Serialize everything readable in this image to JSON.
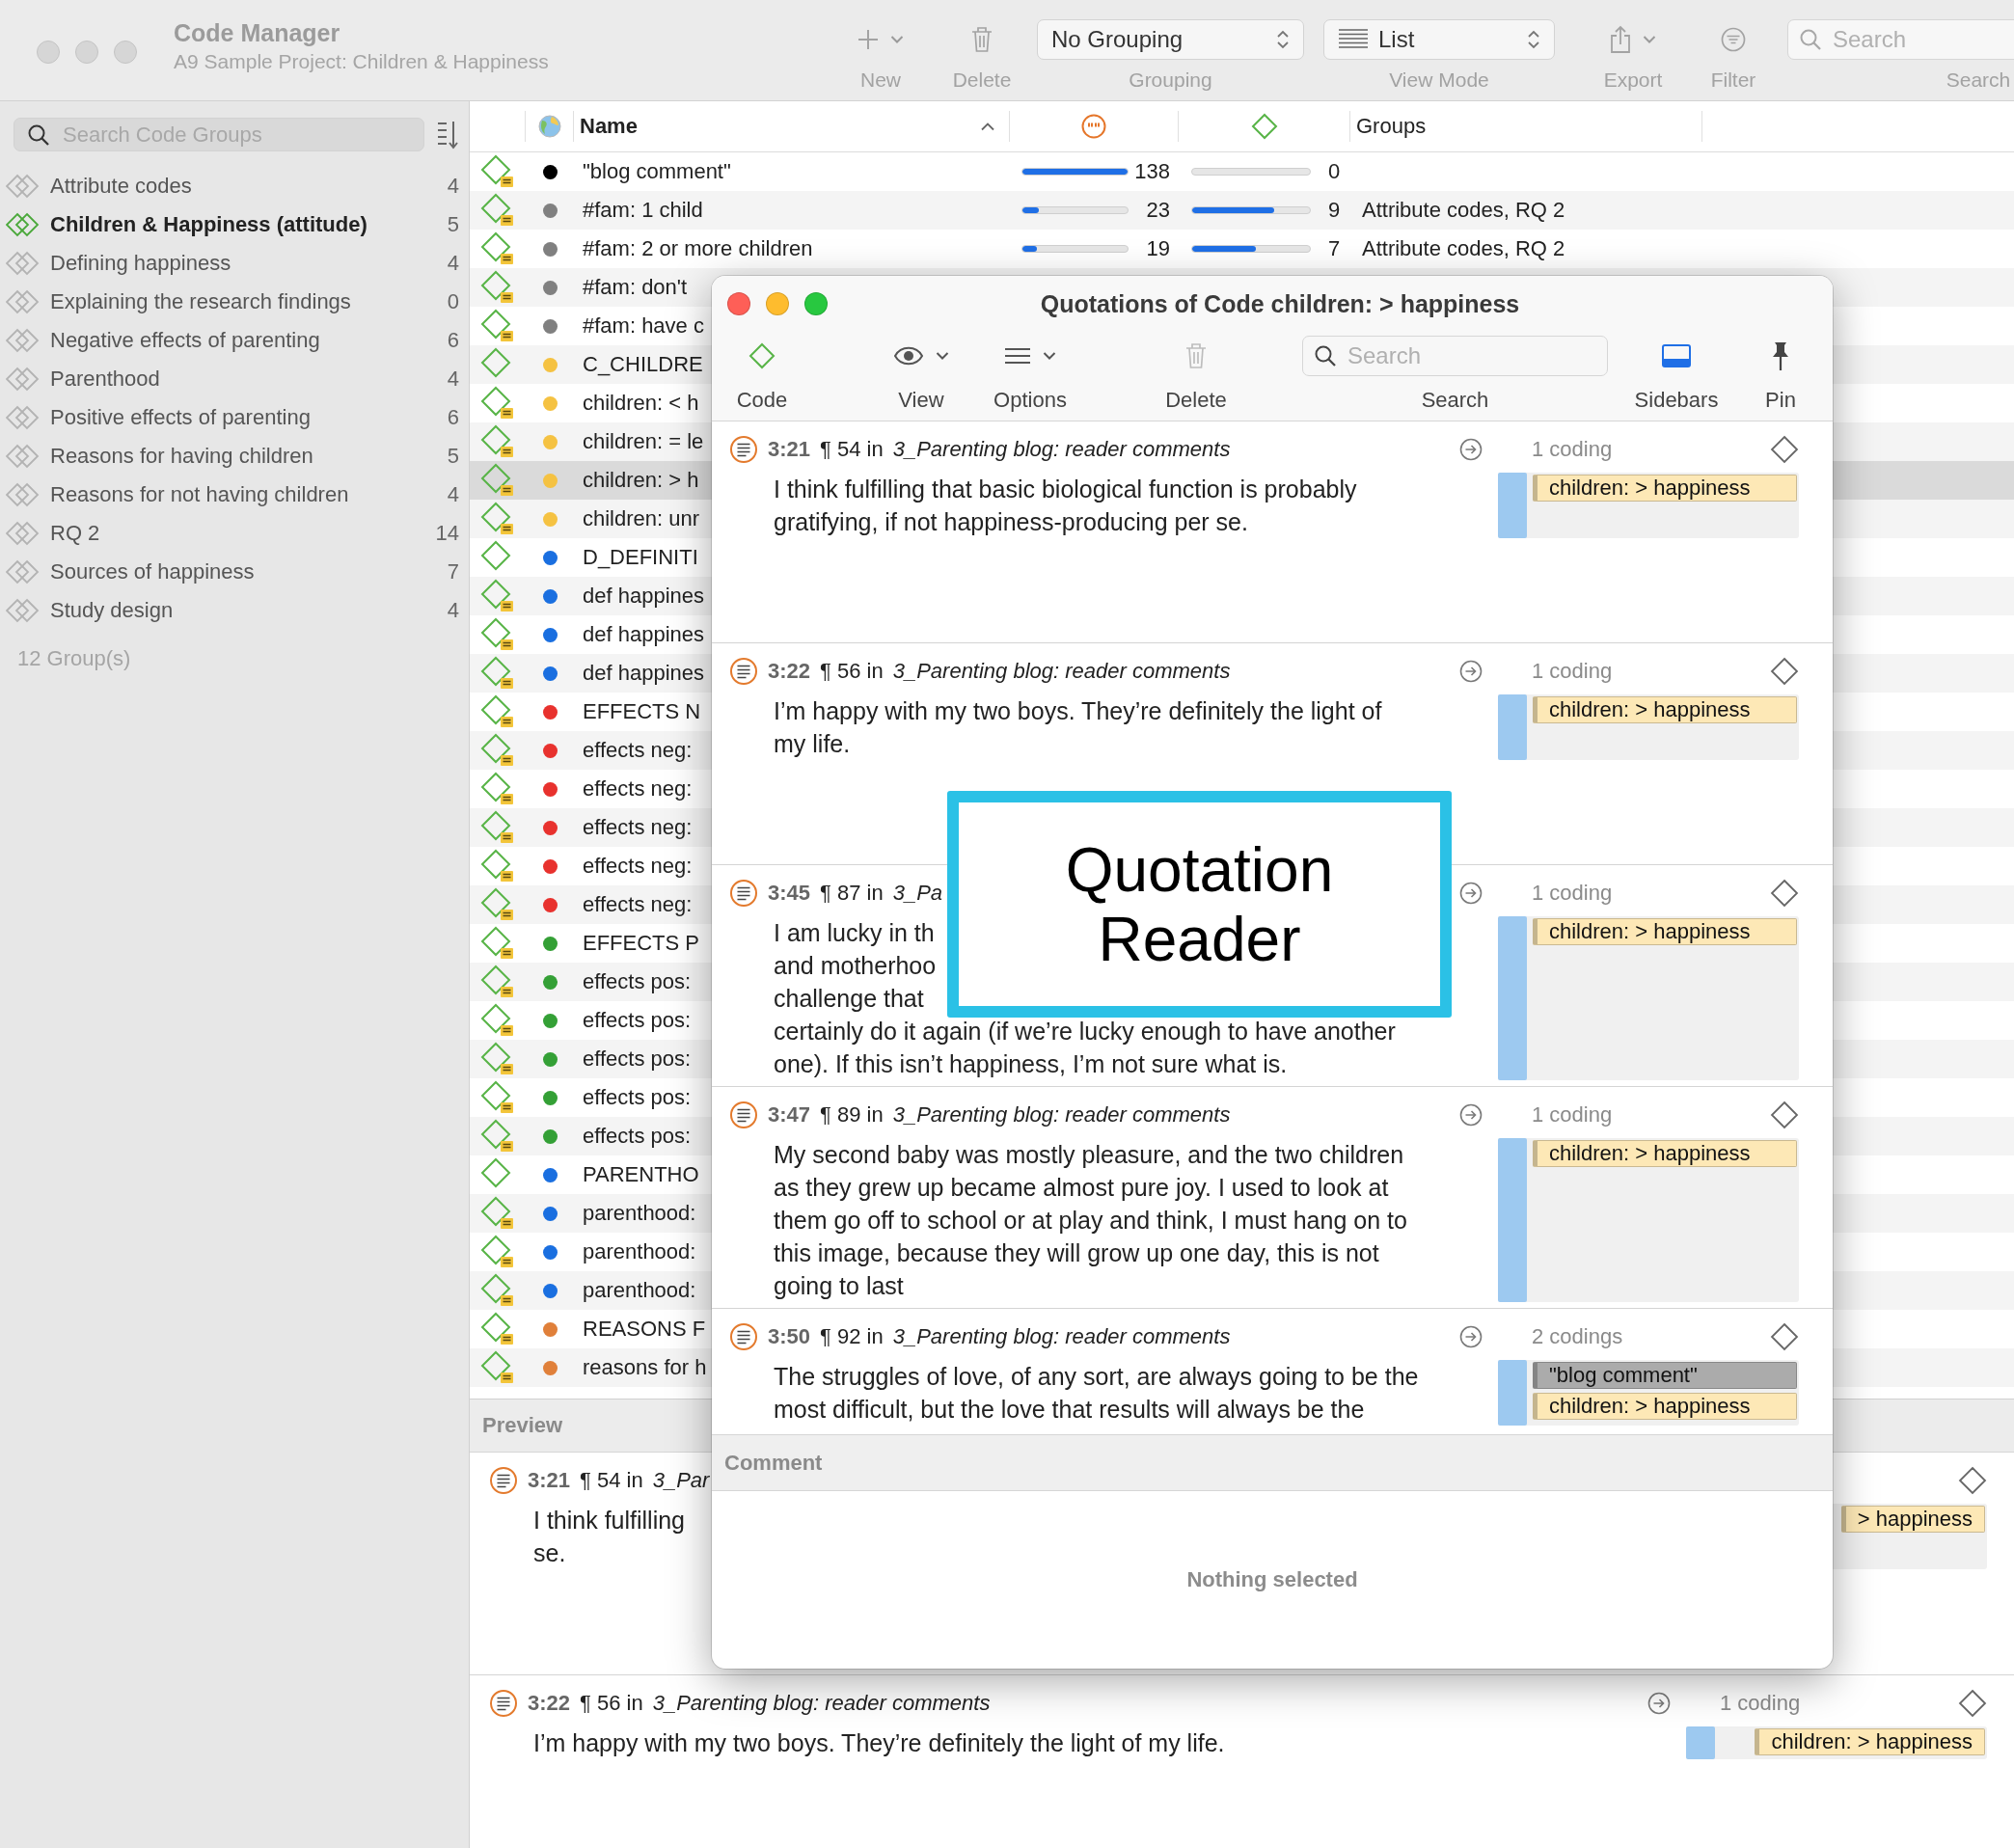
{
  "window": {
    "title": "Code Manager",
    "subtitle": "A9 Sample Project: Children & Happiness"
  },
  "toolbar": {
    "items": [
      {
        "kind": "new",
        "label": "New"
      },
      {
        "kind": "delete",
        "label": "Delete"
      },
      {
        "kind": "popup",
        "value": "No Grouping",
        "label": "Grouping"
      },
      {
        "kind": "popup-list",
        "value": "List",
        "label": "View Mode"
      },
      {
        "kind": "export",
        "label": "Export"
      },
      {
        "kind": "filter",
        "label": "Filter"
      },
      {
        "kind": "search",
        "placeholder": "Search",
        "label": "Search"
      }
    ]
  },
  "sidebar": {
    "search_placeholder": "Search Code Groups",
    "items": [
      {
        "label": "Attribute codes",
        "count": "4",
        "selected": false
      },
      {
        "label": "Children & Happiness (attitude)",
        "count": "5",
        "selected": true
      },
      {
        "label": "Defining happiness",
        "count": "4",
        "selected": false
      },
      {
        "label": "Explaining the research findings",
        "count": "0",
        "selected": false
      },
      {
        "label": "Negative effects of parenting",
        "count": "6",
        "selected": false
      },
      {
        "label": "Parenthood",
        "count": "4",
        "selected": false
      },
      {
        "label": "Positive effects of parenting",
        "count": "6",
        "selected": false
      },
      {
        "label": "Reasons for having children",
        "count": "5",
        "selected": false
      },
      {
        "label": "Reasons for not having children",
        "count": "4",
        "selected": false
      },
      {
        "label": "RQ 2",
        "count": "14",
        "selected": false
      },
      {
        "label": "Sources of happiness",
        "count": "7",
        "selected": false
      },
      {
        "label": "Study design",
        "count": "4",
        "selected": false
      }
    ],
    "footer": "12 Group(s)"
  },
  "table": {
    "columns": [
      {
        "kind": "globe"
      },
      {
        "kind": "text",
        "label": "Name",
        "sorted": true
      },
      {
        "kind": "quote"
      },
      {
        "kind": "code"
      },
      {
        "kind": "text",
        "label": "Groups"
      }
    ],
    "rows": [
      {
        "name": "\"blog comment\"",
        "color": "#000000",
        "commented": true,
        "selected": false,
        "column_3": {
          "level": 1,
          "count": "138"
        },
        "column_4": {
          "level": 0,
          "count": "0"
        }
      },
      {
        "name": "#fam: 1 child",
        "color": "#808080",
        "commented": true,
        "selected": false,
        "column_3": {
          "level": 0.16,
          "count": "23"
        },
        "column_4": {
          "level": 0.7,
          "count": "9"
        },
        "groups": "Attribute codes, RQ 2"
      },
      {
        "name": "#fam: 2 or more  children",
        "color": "#808080",
        "commented": true,
        "selected": false,
        "column_3": {
          "level": 0.14,
          "count": "19"
        },
        "column_4": {
          "level": 0.54,
          "count": "7"
        },
        "groups": "Attribute codes, RQ 2"
      },
      {
        "name": "#fam: don't",
        "color": "#808080",
        "commented": true,
        "selected": false
      },
      {
        "name": "#fam: have c",
        "color": "#808080",
        "commented": true,
        "selected": false
      },
      {
        "name": "C_CHILDRE",
        "color": "#f5c242",
        "commented": false,
        "selected": false
      },
      {
        "name": "children: < h",
        "color": "#f5c242",
        "commented": true,
        "selected": false
      },
      {
        "name": "children: = le",
        "color": "#f5c242",
        "commented": true,
        "selected": false
      },
      {
        "name": "children: > h",
        "color": "#f5c242",
        "commented": true,
        "selected": true
      },
      {
        "name": "children: unr",
        "color": "#f5c242",
        "commented": true,
        "selected": false
      },
      {
        "name": "D_DEFINITI",
        "color": "#1a6fe0",
        "commented": false,
        "selected": false
      },
      {
        "name": "def happines",
        "color": "#1a6fe0",
        "commented": true,
        "selected": false
      },
      {
        "name": "def happines",
        "color": "#1a6fe0",
        "commented": true,
        "selected": false
      },
      {
        "name": "def happines",
        "color": "#1a6fe0",
        "commented": true,
        "selected": false
      },
      {
        "name": "EFFECTS N",
        "color": "#e8322e",
        "commented": true,
        "selected": false
      },
      {
        "name": "effects neg:",
        "color": "#e8322e",
        "commented": true,
        "selected": false
      },
      {
        "name": "effects neg:",
        "color": "#e8322e",
        "commented": true,
        "selected": false
      },
      {
        "name": "effects neg:",
        "color": "#e8322e",
        "commented": true,
        "selected": false
      },
      {
        "name": "effects neg:",
        "color": "#e8322e",
        "commented": true,
        "selected": false
      },
      {
        "name": "effects neg:",
        "color": "#e8322e",
        "commented": true,
        "selected": false
      },
      {
        "name": "EFFECTS P",
        "color": "#34a036",
        "commented": true,
        "selected": false
      },
      {
        "name": "effects pos:",
        "color": "#34a036",
        "commented": true,
        "selected": false
      },
      {
        "name": "effects pos:",
        "color": "#34a036",
        "commented": true,
        "selected": false
      },
      {
        "name": "effects pos:",
        "color": "#34a036",
        "commented": true,
        "selected": false
      },
      {
        "name": "effects pos:",
        "color": "#34a036",
        "commented": true,
        "selected": false
      },
      {
        "name": "effects pos:",
        "color": "#34a036",
        "commented": true,
        "selected": false
      },
      {
        "name": "PARENTHO",
        "color": "#1a6fe0",
        "commented": false,
        "selected": false
      },
      {
        "name": "parenthood:",
        "color": "#1a6fe0",
        "commented": true,
        "selected": false
      },
      {
        "name": "parenthood:",
        "color": "#1a6fe0",
        "commented": true,
        "selected": false
      },
      {
        "name": "parenthood:",
        "color": "#1a6fe0",
        "commented": true,
        "selected": false
      },
      {
        "name": "REASONS F",
        "color": "#e0803a",
        "commented": true,
        "selected": false
      },
      {
        "name": "reasons for h",
        "color": "#e0803a",
        "commented": true,
        "selected": false
      }
    ]
  },
  "preview": {
    "title": "Preview",
    "items": [
      {
        "number": "3:21",
        "location": "¶ 54 in",
        "source": "3_Par",
        "lines": [
          "I think fulfilling",
          "se."
        ],
        "codes": [
          {
            "label": "> happiness",
            "color": "#fde8b6"
          }
        ]
      },
      {
        "number": "3:22",
        "location": "¶ 56 in",
        "source": "3_Parenting blog: reader comments",
        "lines": [
          "I’m happy with my two boys. They’re definitely the light of my life."
        ],
        "codings": "1 coding",
        "codes": [
          {
            "label": "children: > happiness",
            "color": "#fde8b6"
          }
        ]
      }
    ]
  },
  "quotations_window": {
    "title": "Quotations of Code children: > happiness",
    "toolbar": [
      {
        "kind": "code",
        "label": "Code"
      },
      {
        "kind": "view",
        "label": "View"
      },
      {
        "kind": "options",
        "label": "Options"
      },
      {
        "kind": "delete",
        "label": "Delete"
      },
      {
        "kind": "search",
        "placeholder": "Search",
        "label": "Search"
      },
      {
        "kind": "sidebars",
        "label": "Sidebars"
      },
      {
        "kind": "pin",
        "label": "Pin"
      }
    ],
    "items": [
      {
        "number": "3:21",
        "location": "¶ 54 in",
        "source": "3_Parenting blog: reader comments",
        "lines": [
          "I think fulfilling that basic biological function is probably",
          "gratifying, if not happiness-producing per se."
        ],
        "codings": "1 coding",
        "codes": [
          {
            "label": "children: > happiness",
            "color": "#fde8b6"
          }
        ]
      },
      {
        "number": "3:22",
        "location": "¶ 56 in",
        "source": "3_Parenting blog: reader comments",
        "lines": [
          "I’m happy with my two boys. They’re definitely the light of",
          "my life."
        ],
        "codings": "1 coding",
        "codes": [
          {
            "label": "children: > happiness",
            "color": "#fde8b6"
          }
        ]
      },
      {
        "number": "3:45",
        "location": "¶ 87 in",
        "source": "3_Pa",
        "lines": [
          "I am lucky in th",
          "and motherhoo",
          "challenge that",
          "certainly do it again (if we’re lucky enough to have another",
          "one). If this isn’t happiness, I’m not sure what is."
        ],
        "codings": "1 coding",
        "codes": [
          {
            "label": "children: > happiness",
            "color": "#fde8b6"
          }
        ]
      },
      {
        "number": "3:47",
        "location": "¶ 89 in",
        "source": "3_Parenting blog: reader comments",
        "lines": [
          "My second baby was mostly pleasure, and the two children",
          "as they grew up became almost pure joy. I used to look at",
          "them go off to school or at play and think, I must hang on to",
          "this image, because they will grow up one day, this is not",
          "going to last"
        ],
        "codings": "1 coding",
        "codes": [
          {
            "label": "children: > happiness",
            "color": "#fde8b6"
          }
        ]
      },
      {
        "number": "3:50",
        "location": "¶ 92 in",
        "source": "3_Parenting blog: reader comments",
        "lines": [
          "The struggles of love, of any sort, are always going to be the",
          "most difficult, but the love that results will always be the"
        ],
        "codings": "2 codings",
        "codes": [
          {
            "label": "\"blog comment\"",
            "color": "#ababab"
          },
          {
            "label": "children: > happiness",
            "color": "#fde8b6"
          }
        ]
      }
    ],
    "comment": {
      "title": "Comment",
      "empty_text": "Nothing selected"
    }
  },
  "callout": {
    "text": "Quotation Reader"
  }
}
